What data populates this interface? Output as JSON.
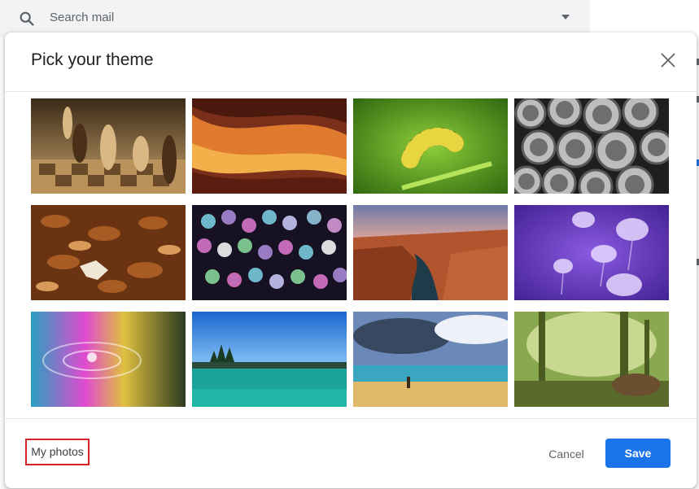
{
  "search": {
    "placeholder": "Search mail"
  },
  "dialog": {
    "title": "Pick your theme",
    "themes": [
      {
        "name": "chess"
      },
      {
        "name": "canyon-cave"
      },
      {
        "name": "caterpillar"
      },
      {
        "name": "pipes"
      },
      {
        "name": "autumn-leaves"
      },
      {
        "name": "bokeh-lights"
      },
      {
        "name": "grand-canyon"
      },
      {
        "name": "jellyfish"
      },
      {
        "name": "water-drop"
      },
      {
        "name": "lake-shore"
      },
      {
        "name": "beach"
      },
      {
        "name": "forest"
      }
    ]
  },
  "footer": {
    "my_photos": "My photos",
    "cancel": "Cancel",
    "save": "Save"
  },
  "colors": {
    "accent": "#1a73e8",
    "highlight_box": "#d8232a"
  }
}
